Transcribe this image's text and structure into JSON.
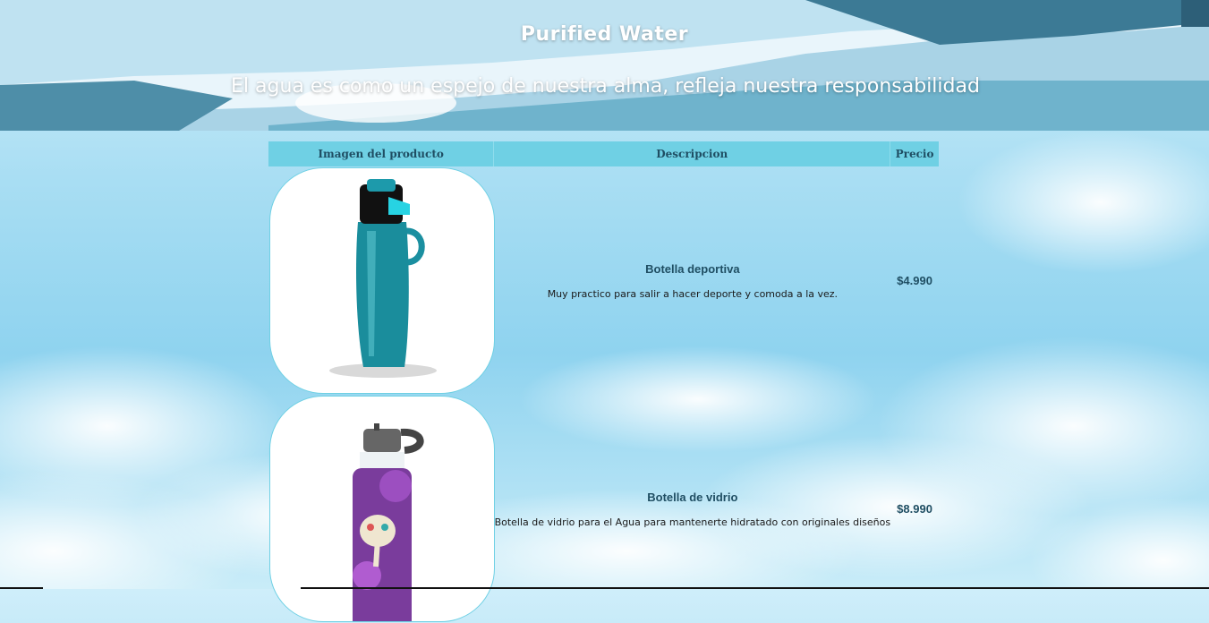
{
  "header": {
    "title": "Purified Water",
    "subtitle": "El agua es como un espejo de nuestra alma, refleja nuestra responsabilidad"
  },
  "table": {
    "headers": [
      "Imagen del producto",
      "Descripcion",
      "Precio"
    ],
    "rows": [
      {
        "name": "Botella deportiva",
        "description": "Muy practico para salir a hacer deporte y comoda a la vez.",
        "price": "$4.990",
        "image_icon": "sports-bottle-image"
      },
      {
        "name": "Botella de vidrio",
        "description": "Botella de vidrio para el Agua para mantenerte hidratado con originales diseños",
        "price": "$8.990",
        "image_icon": "glass-bottle-image"
      }
    ]
  },
  "colors": {
    "header_row": "#6fd0e4",
    "text_dark": "#1f4e63",
    "banner_text": "#ffffff"
  }
}
